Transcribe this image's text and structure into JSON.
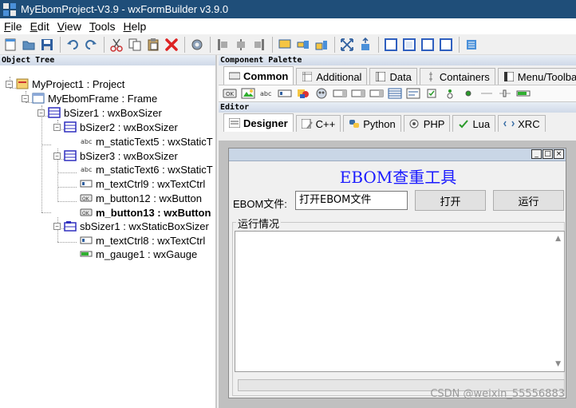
{
  "window": {
    "title": "MyEbomProject-V3.9 - wxFormBuilder v3.9.0"
  },
  "menu": [
    {
      "accel": "F",
      "rest": "ile"
    },
    {
      "accel": "E",
      "rest": "dit"
    },
    {
      "accel": "V",
      "rest": "iew"
    },
    {
      "accel": "T",
      "rest": "ools"
    },
    {
      "accel": "H",
      "rest": "elp"
    }
  ],
  "object_tree": {
    "caption": "Object Tree",
    "items": [
      {
        "label": "MyProject1 : Project"
      },
      {
        "label": "MyEbomFrame : Frame"
      },
      {
        "label": "bSizer1 : wxBoxSizer"
      },
      {
        "label": "bSizer2 : wxBoxSizer"
      },
      {
        "label": "m_staticText5 : wxStaticT"
      },
      {
        "label": "bSizer3 : wxBoxSizer"
      },
      {
        "label": "m_staticText6 : wxStaticT"
      },
      {
        "label": "m_textCtrl9 : wxTextCtrl"
      },
      {
        "label": "m_button12 : wxButton"
      },
      {
        "label": "m_button13 : wxButton"
      },
      {
        "label": "sbSizer1 : wxStaticBoxSizer"
      },
      {
        "label": "m_textCtrl8 : wxTextCtrl"
      },
      {
        "label": "m_gauge1 : wxGauge"
      }
    ]
  },
  "palette": {
    "caption": "Component Palette",
    "tabs": [
      "Common",
      "Additional",
      "Data",
      "Containers",
      "Menu/Toolbar"
    ]
  },
  "editor": {
    "caption": "Editor",
    "tabs": [
      "Designer",
      "C++",
      "Python",
      "PHP",
      "Lua",
      "XRC"
    ]
  },
  "design": {
    "heading": "EBOM查重工具",
    "ebom_label": "EBOM文件:",
    "ebom_value": "打开EBOM文件",
    "open_button": "打开",
    "run_button": "运行",
    "group_label": "运行情况"
  },
  "watermark": "CSDN @weixin_55556883"
}
